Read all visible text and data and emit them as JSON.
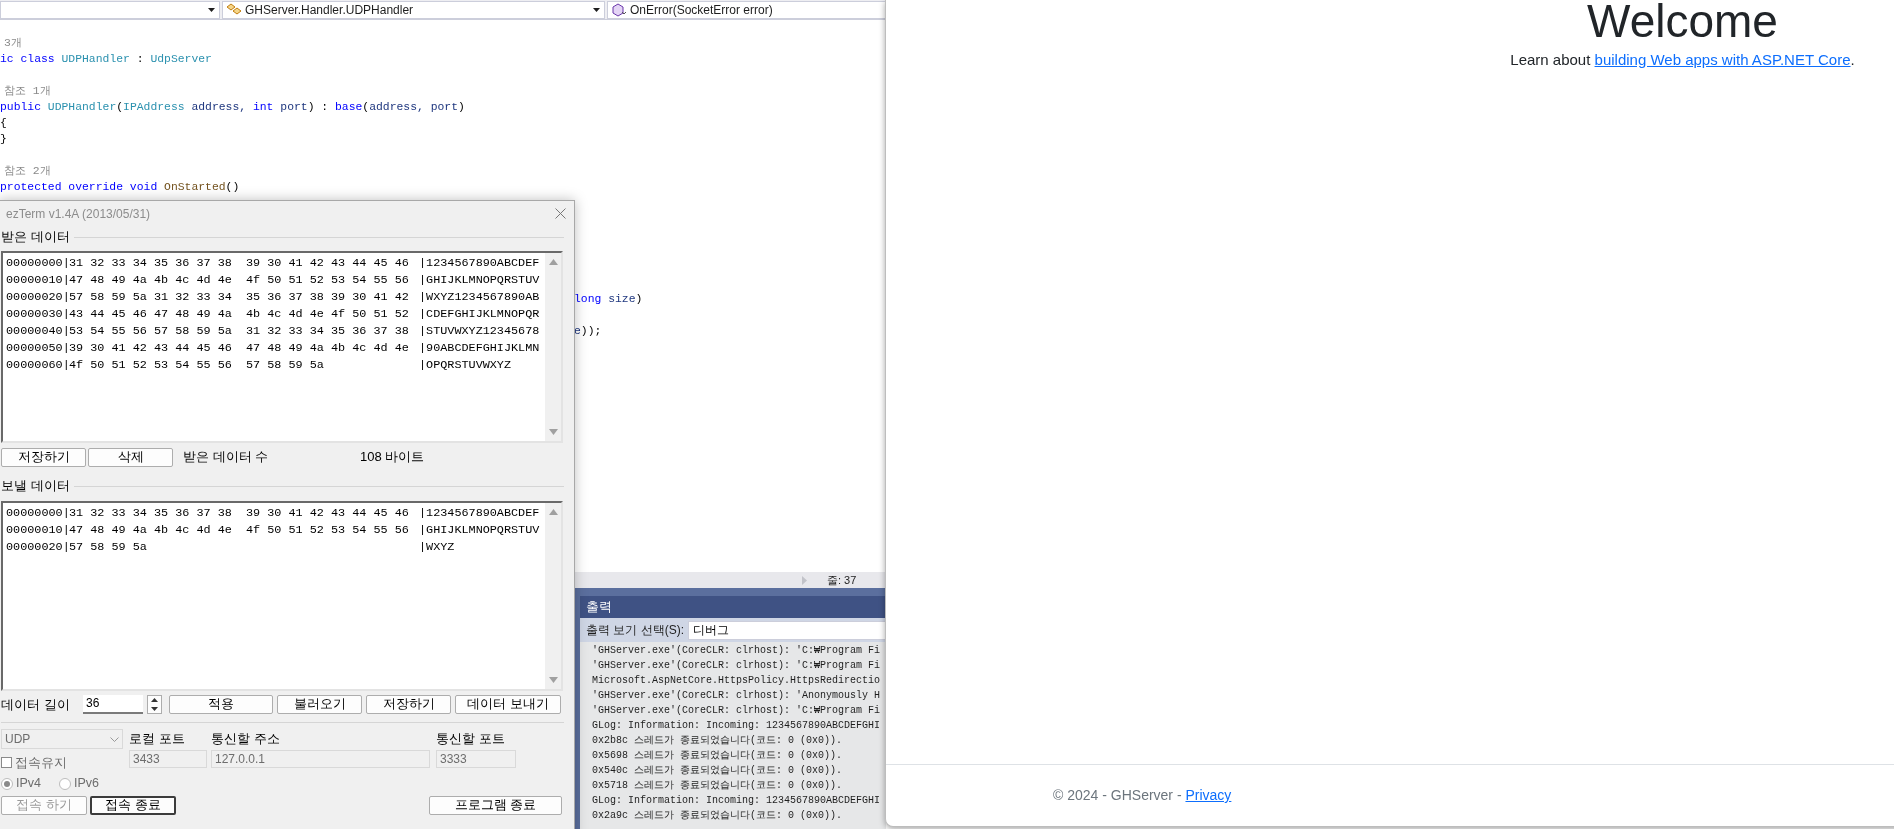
{
  "editor": {
    "nav": [
      {
        "label": "GHServer.Handler.UDPHandler"
      },
      {
        "label": "OnError(SocketError error)"
      }
    ],
    "code_lines": [
      {
        "kind": "lens",
        "text": "3개"
      },
      {
        "kind": "code",
        "tokens": [
          {
            "t": "ic class ",
            "kind": "kw"
          },
          {
            "t": "UDPHandler",
            "kind": "type"
          },
          {
            "t": " : ",
            "kind": "plain"
          },
          {
            "t": "UdpServer",
            "kind": "type"
          }
        ]
      },
      {
        "kind": "blank"
      },
      {
        "kind": "lens",
        "text": "참조 1개"
      },
      {
        "kind": "code",
        "tokens": [
          {
            "t": "public ",
            "kind": "kw"
          },
          {
            "t": "UDPHandler",
            "kind": "type"
          },
          {
            "t": "(",
            "kind": "plain"
          },
          {
            "t": "IPAddress",
            "kind": "type"
          },
          {
            "t": " address, ",
            "kind": "param"
          },
          {
            "t": "int ",
            "kind": "kw"
          },
          {
            "t": "port",
            "kind": "param"
          },
          {
            "t": ") : ",
            "kind": "plain"
          },
          {
            "t": "base",
            "kind": "kw"
          },
          {
            "t": "(",
            "kind": "plain"
          },
          {
            "t": "address, port",
            "kind": "param"
          },
          {
            "t": ")",
            "kind": "plain"
          }
        ]
      },
      {
        "kind": "code",
        "tokens": [
          {
            "t": "{",
            "kind": "plain"
          }
        ]
      },
      {
        "kind": "code",
        "tokens": [
          {
            "t": "}",
            "kind": "plain"
          }
        ]
      },
      {
        "kind": "blank"
      },
      {
        "kind": "lens",
        "text": "참조 2개"
      },
      {
        "kind": "code",
        "tokens": [
          {
            "t": "protected override void ",
            "kind": "kw"
          },
          {
            "t": "OnStarted",
            "kind": "method"
          },
          {
            "t": "()",
            "kind": "plain"
          }
        ]
      },
      {
        "kind": "blank"
      },
      {
        "kind": "blank"
      },
      {
        "kind": "blank"
      },
      {
        "kind": "blank"
      },
      {
        "kind": "blank"
      },
      {
        "kind": "blank"
      },
      {
        "kind": "code",
        "covered": true,
        "tokens": [
          {
            "t": "long",
            "kind": "kw"
          },
          {
            "t": " size",
            "kind": "param"
          },
          {
            "t": ")",
            "kind": "plain"
          }
        ]
      },
      {
        "kind": "blank"
      },
      {
        "kind": "code",
        "covered": true,
        "tokens": [
          {
            "t": "e",
            "kind": "param"
          },
          {
            "t": "));",
            "kind": "plain"
          }
        ]
      }
    ],
    "status": {
      "line": "줄: 37"
    },
    "output": {
      "title": "출력",
      "select_label": "출력 보기 선택(S):",
      "select_value": "디버그",
      "lines": [
        "'GHServer.exe'(CoreCLR: clrhost): 'C:₩Program Fi",
        "'GHServer.exe'(CoreCLR: clrhost): 'C:₩Program Fi",
        "Microsoft.AspNetCore.HttpsPolicy.HttpsRedirectio",
        "'GHServer.exe'(CoreCLR: clrhost): 'Anonymously H",
        "'GHServer.exe'(CoreCLR: clrhost): 'C:₩Program Fi",
        "GLog: Information: Incoming: 1234567890ABCDEFGHI",
        "0x2b8c 스레드가 종료되었습니다(코드: 0 (0x0)).",
        "0x5698 스레드가 종료되었습니다(코드: 0 (0x0)).",
        "0x540c 스레드가 종료되었습니다(코드: 0 (0x0)).",
        "0x5718 스레드가 종료되었습니다(코드: 0 (0x0)).",
        "GLog: Information: Incoming: 1234567890ABCDEFGHI",
        "0x2a9c 스레드가 종료되었습니다(코드: 0 (0x0))."
      ]
    }
  },
  "ezterm": {
    "title": "ezTerm v1.4A (2013/05/31)",
    "received": {
      "label": "받은 데이터",
      "rows": [
        {
          "offset": "00000000|",
          "hex": "31 32 33 34 35 36 37 38  39 30 41 42 43 44 45 46",
          "ascii": "|1234567890ABCDEF"
        },
        {
          "offset": "00000010|",
          "hex": "47 48 49 4a 4b 4c 4d 4e  4f 50 51 52 53 54 55 56",
          "ascii": "|GHIJKLMNOPQRSTUV"
        },
        {
          "offset": "00000020|",
          "hex": "57 58 59 5a 31 32 33 34  35 36 37 38 39 30 41 42",
          "ascii": "|WXYZ1234567890AB"
        },
        {
          "offset": "00000030|",
          "hex": "43 44 45 46 47 48 49 4a  4b 4c 4d 4e 4f 50 51 52",
          "ascii": "|CDEFGHIJKLMNOPQR"
        },
        {
          "offset": "00000040|",
          "hex": "53 54 55 56 57 58 59 5a  31 32 33 34 35 36 37 38",
          "ascii": "|STUVWXYZ12345678"
        },
        {
          "offset": "00000050|",
          "hex": "39 30 41 42 43 44 45 46  47 48 49 4a 4b 4c 4d 4e",
          "ascii": "|90ABCDEFGHIJKLMN"
        },
        {
          "offset": "00000060|",
          "hex": "4f 50 51 52 53 54 55 56  57 58 59 5a",
          "ascii": "|OPQRSTUVWXYZ"
        }
      ],
      "buttons": [
        "저장하기",
        "삭제"
      ],
      "count_label": "받은 데이터 수",
      "count": "108 바이트"
    },
    "send": {
      "label": "보낼 데이터",
      "rows": [
        {
          "offset": "00000000|",
          "hex": "31 32 33 34 35 36 37 38  39 30 41 42 43 44 45 46",
          "ascii": "|1234567890ABCDEF"
        },
        {
          "offset": "00000010|",
          "hex": "47 48 49 4a 4b 4c 4d 4e  4f 50 51 52 53 54 55 56",
          "ascii": "|GHIJKLMNOPQRSTUV"
        },
        {
          "offset": "00000020|",
          "hex": "57 58 59 5a",
          "ascii": "|WXYZ"
        }
      ],
      "length_label": "데이터 길이",
      "length": "36",
      "buttons": [
        "적용",
        "불러오기",
        "저장하기",
        "데이터 보내기"
      ]
    },
    "connection": {
      "disabled": true,
      "protocol": "UDP",
      "local_port_label": "로컬 포트",
      "local_port": "3433",
      "remote_addr_label": "통신할 주소",
      "remote_addr": "127.0.0.1",
      "remote_port_label": "통신할 포트",
      "remote_port": "3333",
      "keep_alive": {
        "label": "접속유지",
        "checked": false
      },
      "ip_versions": [
        {
          "label": "IPv4",
          "selected": true
        },
        {
          "label": "IPv6",
          "selected": false
        }
      ],
      "buttons": [
        {
          "label": "접속 하기",
          "disabled": true,
          "focused": false
        },
        {
          "label": "접속 종료",
          "disabled": false,
          "focused": true
        },
        {
          "label": "프로그램 종료",
          "disabled": false,
          "focused": false
        }
      ]
    }
  },
  "browser": {
    "heading": "Welcome",
    "intro": "Learn about ",
    "link": "building Web apps with ASP.NET Core",
    "intro_end": ".",
    "footer": "© 2024 - GHServer - ",
    "footer_link": "Privacy"
  }
}
